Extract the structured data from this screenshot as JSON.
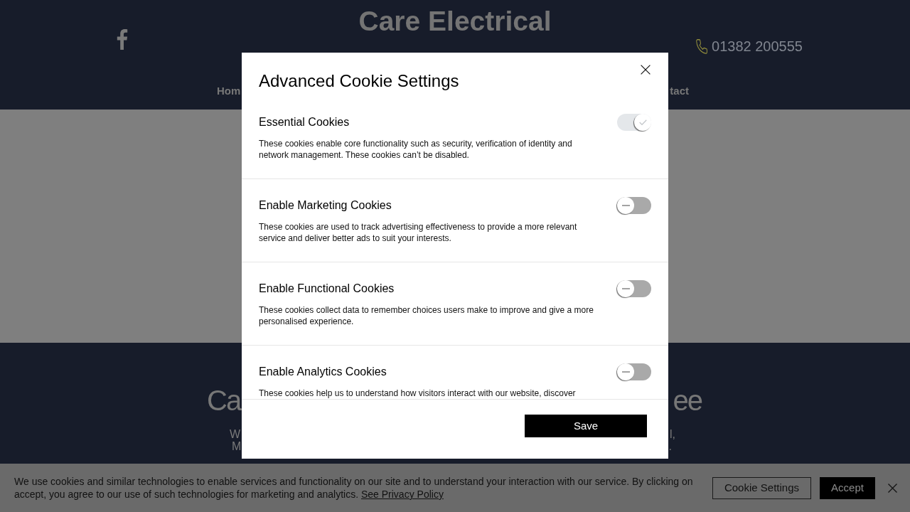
{
  "header": {
    "title": "Care Electrical",
    "phone": "01382 200555",
    "nav_items": [
      "Hom",
      "tact"
    ]
  },
  "intro_section": {
    "heading_fragments": [
      "Ca",
      "ee"
    ],
    "text_rows": [
      {
        "left": "W",
        "right": "l,"
      },
      {
        "left": "M",
        "right": "."
      }
    ]
  },
  "cookie_dialog": {
    "title": "Advanced Cookie Settings",
    "sections": [
      {
        "title": "Essential Cookies",
        "description": "These cookies enable core functionality such as security, verification of identity and network management. These cookies can’t be disabled.",
        "on": true,
        "disabled": true
      },
      {
        "title": "Enable Marketing Cookies",
        "description": "These cookies are used to track advertising effectiveness to provide a more relevant service and deliver better ads to suit your interests.",
        "on": false,
        "disabled": false
      },
      {
        "title": "Enable Functional Cookies",
        "description": "These cookies collect data to remember choices users make to improve and give a more personalised experience.",
        "on": false,
        "disabled": false
      },
      {
        "title": "Enable Analytics Cookies",
        "description": "These cookies help us to understand how visitors interact with our website, discover",
        "on": false,
        "disabled": false
      }
    ],
    "save_button": "Save"
  },
  "cookie_banner": {
    "text": "We use cookies and similar technologies to enable services and functionality on our site and to understand your interaction with our service. By clicking on accept, you agree to our use of such technologies for marketing and analytics.",
    "link": "See Privacy Policy",
    "buttons": [
      {
        "label": "Cookie Settings",
        "kind": "secondary"
      },
      {
        "label": "Accept",
        "kind": "primary"
      }
    ]
  }
}
